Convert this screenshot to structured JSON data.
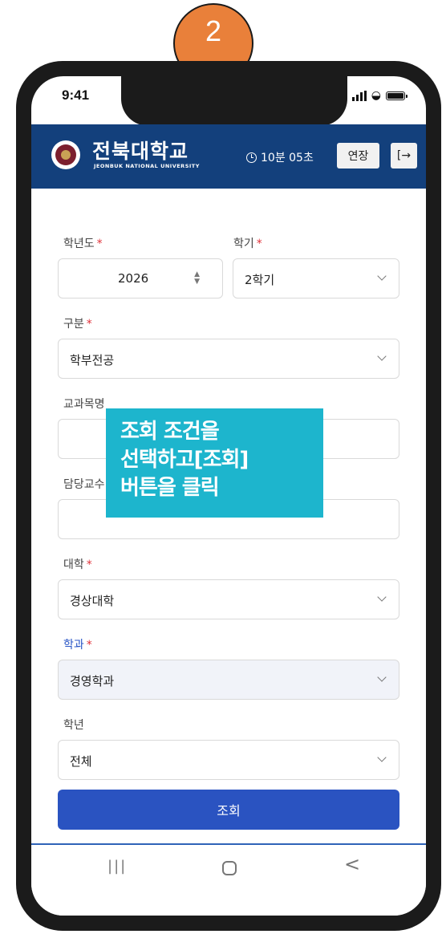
{
  "step_number": "2",
  "status_bar": {
    "time": "9:41"
  },
  "header": {
    "logo_name": "전북대학교",
    "logo_sub": "JEONBUK NATIONAL UNIVERSITY",
    "timer": "10분 05초",
    "extend_label": "연장",
    "logout_icon": "[→"
  },
  "form": {
    "year_label": "학년도",
    "year_value": "2026",
    "semester_label": "학기",
    "semester_value": "2학기",
    "category_label": "구분",
    "category_value": "학부전공",
    "course_label": "교과목명",
    "course_value": "",
    "professor_label": "담당교수",
    "professor_value": "",
    "college_label": "대학",
    "college_value": "경상대학",
    "department_label": "학과",
    "department_value": "경영학과",
    "grade_label": "학년",
    "grade_value": "전체",
    "required_mark": "*",
    "search_button": "조회"
  },
  "tooltip": {
    "line1": "조회 조건을",
    "line2": "선택하고[조회]",
    "line3": "버튼을 클릭"
  },
  "navbar": {
    "recent_icon": "|||",
    "back_icon": "<"
  }
}
